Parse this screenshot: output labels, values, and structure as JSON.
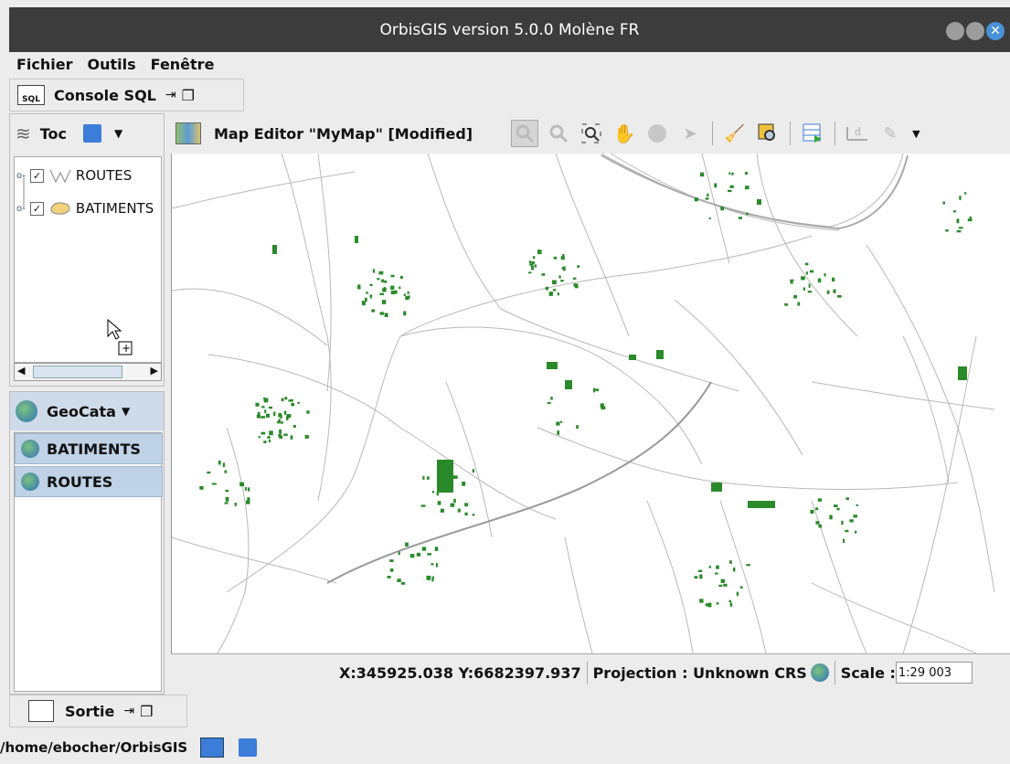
{
  "window": {
    "title": "OrbisGIS version 5.0.0 Molène FR"
  },
  "menu": {
    "items": [
      "Fichier",
      "Outils",
      "Fenêtre"
    ]
  },
  "console": {
    "label": "Console SQL",
    "sql_icon_text": "SQL"
  },
  "toc": {
    "label": "Toc",
    "layers": [
      {
        "label": "ROUTES",
        "checked": true,
        "icon": "line-layer-icon"
      },
      {
        "label": "BATIMENTS",
        "checked": true,
        "icon": "polygon-layer-icon"
      }
    ]
  },
  "geocatalog": {
    "label": "GeoCata",
    "items": [
      {
        "label": "BATIMENTS"
      },
      {
        "label": "ROUTES"
      }
    ]
  },
  "map_editor": {
    "title": "Map Editor \"MyMap\" [Modified]",
    "toolbar": [
      "zoom-in-icon",
      "zoom-out-icon",
      "full-extent-icon",
      "pan-icon",
      "record-icon",
      "select-icon",
      "clear-selection-icon",
      "zoom-to-selection-icon",
      "table-icon",
      "measure-icon",
      "draw-icon"
    ]
  },
  "status": {
    "coords": "X:345925.038 Y:6682397.937",
    "projection": "Projection : Unknown CRS",
    "scale_label": "Scale :",
    "scale_value": "1:29 003"
  },
  "sortie": {
    "label": "Sortie"
  },
  "path": {
    "text": "/home/ebocher/OrbisGIS"
  },
  "colors": {
    "building": "#2a8a2a",
    "road": "#b8b8b8",
    "titlebar": "#3c3c3c",
    "selection": "#bfd2e6"
  }
}
